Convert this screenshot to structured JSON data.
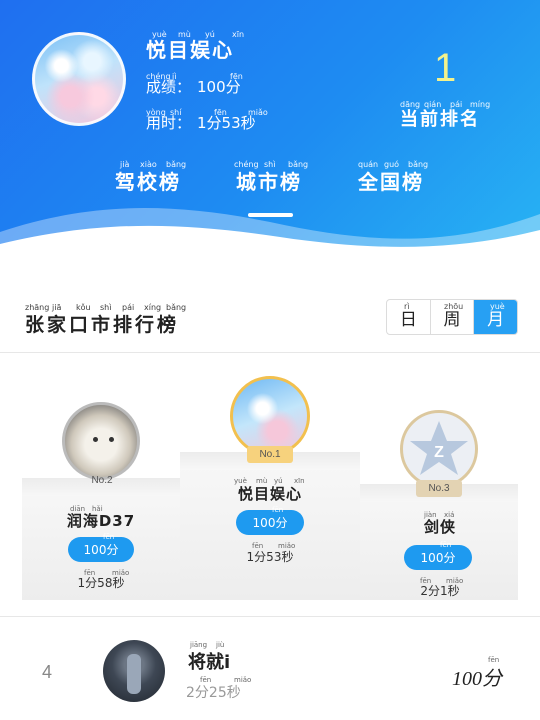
{
  "header": {
    "user_name": "悦目娱心",
    "user_name_pinyin": [
      "yuè",
      "mù",
      "yú",
      "xīn"
    ],
    "score_label": "成绩：",
    "score_label_pinyin": [
      "chéng",
      "jì"
    ],
    "score_value": "100分",
    "score_value_pinyin": "fēn",
    "time_label": "用时：",
    "time_label_pinyin": [
      "yòng",
      "shí"
    ],
    "time_value": "1分53秒",
    "time_value_pinyin": [
      "fēn",
      "miǎo"
    ],
    "current_rank": "1",
    "current_rank_label": "当前排名",
    "current_rank_pinyin": [
      "dāng",
      "qián",
      "pái",
      "míng"
    ],
    "tabs": [
      {
        "label": "驾校榜",
        "pinyin": [
          "jià",
          "xiào",
          "bǎng"
        ]
      },
      {
        "label": "城市榜",
        "pinyin": [
          "chéng",
          "shì",
          "bǎng"
        ]
      },
      {
        "label": "全国榜",
        "pinyin": [
          "quán",
          "guó",
          "bǎng"
        ]
      }
    ],
    "active_tab": "城市榜",
    "background_color": "#1e8cf2"
  },
  "ranking": {
    "title": "张家口市排行榜",
    "title_pinyin": [
      "zhāng",
      "jiā",
      "kǒu",
      "shì",
      "pái",
      "xíng",
      "bǎng"
    ],
    "periods": [
      {
        "label": "日",
        "pinyin": "rì"
      },
      {
        "label": "周",
        "pinyin": "zhōu"
      },
      {
        "label": "月",
        "pinyin": "yuè"
      }
    ],
    "active_period": "月",
    "accent_color": "#27a0f3"
  },
  "podium": [
    {
      "place": "No.2",
      "name": "润海D37",
      "name_pinyin": [
        "diān",
        "hǎi"
      ],
      "score": "100分",
      "score_pinyin": "fēn",
      "time": "1分58秒",
      "time_pinyin": [
        "fēn",
        "miǎo"
      ],
      "badge_color": "#e6e6e6",
      "avatar": "cat-avatar"
    },
    {
      "place": "No.1",
      "name": "悦目娱心",
      "name_pinyin": [
        "yuè",
        "mù",
        "yú",
        "xīn"
      ],
      "score": "100分",
      "score_pinyin": "fēn",
      "time": "1分53秒",
      "time_pinyin": [
        "fēn",
        "miǎo"
      ],
      "badge_color": "#f7d27d",
      "avatar": "sky-avatar"
    },
    {
      "place": "No.3",
      "name": "剑侠",
      "name_pinyin": [
        "jiàn",
        "xiá"
      ],
      "score": "100分",
      "score_pinyin": "fēn",
      "time": "2分1秒",
      "time_pinyin": [
        "fēn",
        "miǎo"
      ],
      "badge_color": "#e3d3b3",
      "avatar": "star-avatar"
    }
  ],
  "list": [
    {
      "rank": "4",
      "name": "将就i",
      "name_pinyin": [
        "jiāng",
        "jiù"
      ],
      "time": "2分25秒",
      "time_pinyin": [
        "fēn",
        "miǎo"
      ],
      "score": "100分",
      "score_pinyin": "fēn",
      "avatar": "photo-avatar"
    }
  ]
}
